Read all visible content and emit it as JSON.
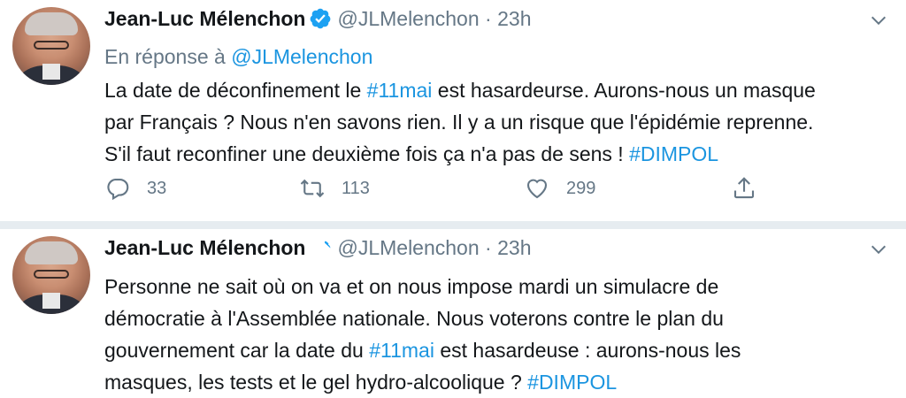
{
  "tweets": [
    {
      "author_name": "Jean-Luc Mélenchon",
      "handle": "@JLMelenchon",
      "separator": "·",
      "time": "23h",
      "reply_prefix": "En réponse à",
      "reply_mention": "@JLMelenchon",
      "text_lines": [
        {
          "a": "La date de déconfinement le ",
          "tag": "#11mai",
          "b": " est hasardeurse. Aurons-nous un masque"
        },
        {
          "a": "par Français ? Nous n'en savons rien. Il y a un risque que l'épidémie reprenne.",
          "tag": "",
          "b": ""
        },
        {
          "a": "S'il faut reconfiner une deuxième fois ça n'a pas de sens ! ",
          "tag": "#DIMPOL",
          "b": ""
        }
      ],
      "replies": "33",
      "retweets": "113",
      "likes": "299"
    },
    {
      "author_name": "Jean-Luc Mélenchon",
      "handle": "@JLMelenchon",
      "separator": "·",
      "time": "23h",
      "text_lines": [
        {
          "a": "Personne ne sait où on va et on nous impose mardi un simulacre de",
          "tag": "",
          "b": ""
        },
        {
          "a": "démocratie à l'Assemblée nationale. Nous voterons contre le plan du",
          "tag": "",
          "b": ""
        },
        {
          "a": "gouvernement car la date du ",
          "tag": "#11mai",
          "b": " est hasardeuse : aurons-nous les"
        },
        {
          "a": "masques, les tests et le gel hydro-alcoolique ? ",
          "tag": "#DIMPOL",
          "b": ""
        }
      ]
    }
  ],
  "icons": {
    "verified": "verified-badge-icon",
    "more": "chevron-down-icon",
    "reply": "reply-bubble-icon",
    "retweet": "retweet-icon",
    "like": "heart-icon",
    "share": "share-icon"
  },
  "colors": {
    "link": "#1b95e0",
    "secondary_text": "#657786",
    "separator": "#e6ecf0"
  }
}
